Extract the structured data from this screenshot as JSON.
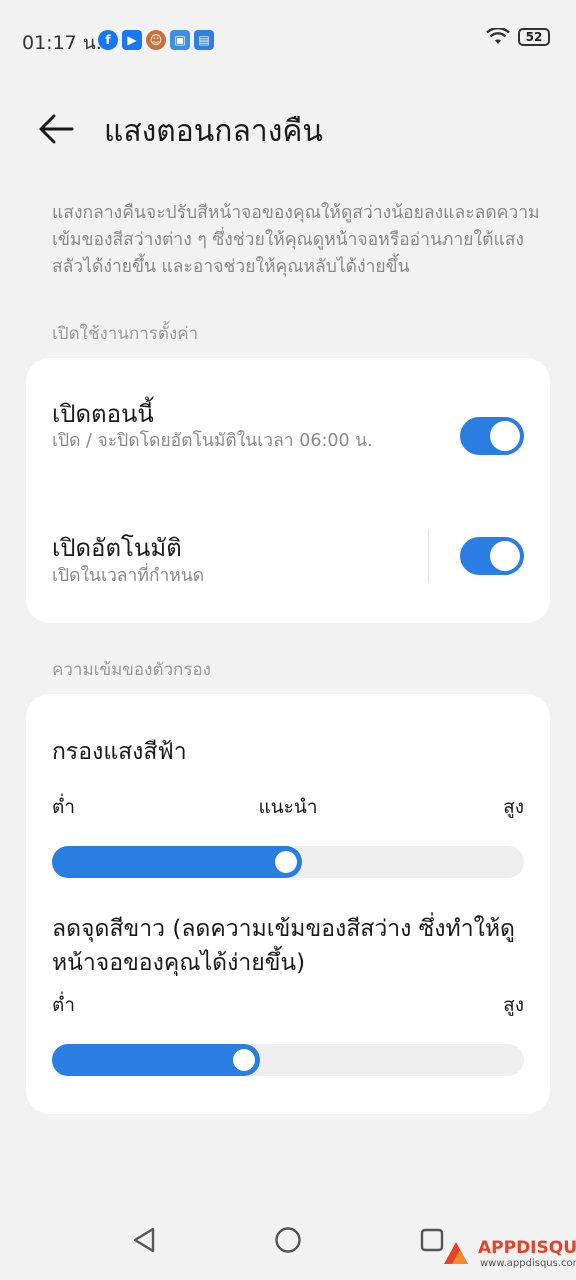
{
  "status_bar": {
    "time": "01:17 น.",
    "battery": "52",
    "notification_icons": [
      "facebook-icon",
      "play-icon",
      "avatar-icon",
      "app-icon",
      "news-icon"
    ]
  },
  "header": {
    "title": "แสงตอนกลางคืน"
  },
  "description": "แสงกลางคืนจะปรับสีหน้าจอของคุณให้ดูสว่างน้อยลงและลดความเข้มของสีสว่างต่าง ๆ ซึ่งช่วยให้คุณดูหน้าจอหรืออ่านภายใต้แสงสลัวได้ง่ายขึ้น และอาจช่วยให้คุณหลับได้ง่ายขึ้น",
  "section_enable": {
    "label": "เปิดใช้งานการตั้งค่า",
    "rows": [
      {
        "title": "เปิดตอนนี้",
        "subtitle": "เปิด / จะปิดโดยอัตโนมัติในเวลา 06:00 น.",
        "toggle_on": true
      },
      {
        "title": "เปิดอัตโนมัติ",
        "subtitle": "เปิดในเวลาที่กำหนด",
        "toggle_on": true
      }
    ]
  },
  "section_filter": {
    "label": "ความเข้มของตัวกรอง",
    "blue_filter": {
      "title": "กรองแสงสีฟ้า",
      "low_label": "ต่ำ",
      "mid_label": "แนะนำ",
      "high_label": "สูง",
      "value_fraction": 0.53
    },
    "white_point": {
      "title": "ลดจุดสีขาว (ลดความเข้มของสีสว่าง ซึ่งทำให้ดูหน้าจอของคุณได้ง่ายขึ้น)",
      "low_label": "ต่ำ",
      "high_label": "สูง",
      "value_fraction": 0.44
    }
  },
  "nav_bar": {
    "buttons": [
      "back-nav-icon",
      "home-nav-icon",
      "recents-nav-icon"
    ]
  },
  "watermark": {
    "brand": "APPDISQUS",
    "url": "www.appdisqus.com"
  },
  "colors": {
    "accent": "#2a7de1",
    "background": "#f2f2f2",
    "card": "#ffffff",
    "secondary_text": "#8a8a8a"
  }
}
